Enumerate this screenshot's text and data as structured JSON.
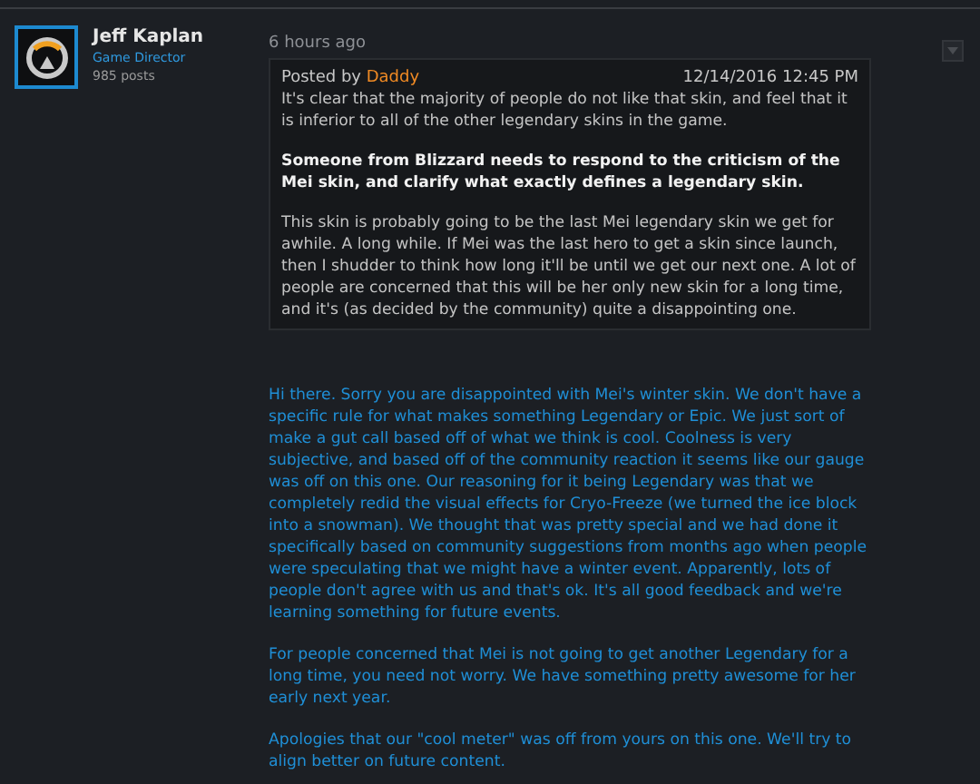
{
  "author": {
    "name": "Jeff Kaplan",
    "role": "Game Director",
    "posts": "985 posts"
  },
  "post": {
    "time": "6 hours ago",
    "quote": {
      "prefix": "Posted by",
      "user": "Daddy",
      "date": "12/14/2016 12:45 PM",
      "paragraphs": [
        {
          "kind": "plain",
          "text": "It's clear that the majority of people do not like that skin, and feel that it is inferior to all of the other legendary skins in the game."
        },
        {
          "kind": "bold",
          "text": "Someone from Blizzard needs to respond to the criticism of the Mei skin, and clarify what exactly defines a legendary skin."
        },
        {
          "kind": "plain",
          "text": "This skin is probably going to be the last Mei legendary skin we get for awhile. A long while. If Mei was the last hero to get a skin since launch, then I shudder to think how long it'll be until we get our next one. A lot of people are concerned that this will be her only new skin for a long time, and it's (as decided by the community) quite a disappointing one."
        }
      ]
    },
    "reply": [
      "Hi there. Sorry you are disappointed with Mei's winter skin. We don't have a specific rule for what makes something Legendary or Epic. We just sort of make a gut call based off of what we think is cool. Coolness is very subjective, and based off of the community reaction it seems like our gauge was off on this one. Our reasoning for it being Legendary was that we completely redid the visual effects for Cryo-Freeze (we turned the ice block into a snowman). We thought that was pretty special and we had done it specifically based on community suggestions from months ago when people were speculating that we might have a winter event. Apparently, lots of people don't agree with us and that's ok. It's all good feedback and we're learning something for future events.",
      "For people concerned that Mei is not going to get another Legendary for a long time, you need not worry. We have something pretty awesome for her early next year.",
      "Apologies that our \"cool meter\" was off from yours on this one. We'll try to align better on future content."
    ]
  }
}
